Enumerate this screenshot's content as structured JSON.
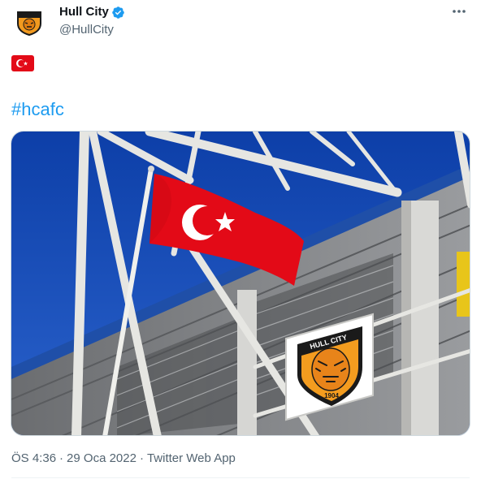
{
  "tweet": {
    "author": {
      "name": "Hull City",
      "handle": "@HullCity",
      "verified": true,
      "avatar_icon": "hull-city-crest-icon"
    },
    "more_icon": "more-dots-icon",
    "body": {
      "emoji": "turkish-flag-emoji",
      "hashtag": "#hcafc"
    },
    "media": {
      "type": "photo",
      "crest_text": "HULL CITY",
      "crest_year": "1904"
    },
    "meta": {
      "time": "ÖS 4:36",
      "date": "29 Oca 2022",
      "source": "Twitter Web App",
      "separator": "·"
    }
  },
  "colors": {
    "accent": "#1d9bf0",
    "text_primary": "#0f1419",
    "text_secondary": "#536471",
    "flag_red": "#e30a17",
    "crest_orange": "#f5a623"
  }
}
